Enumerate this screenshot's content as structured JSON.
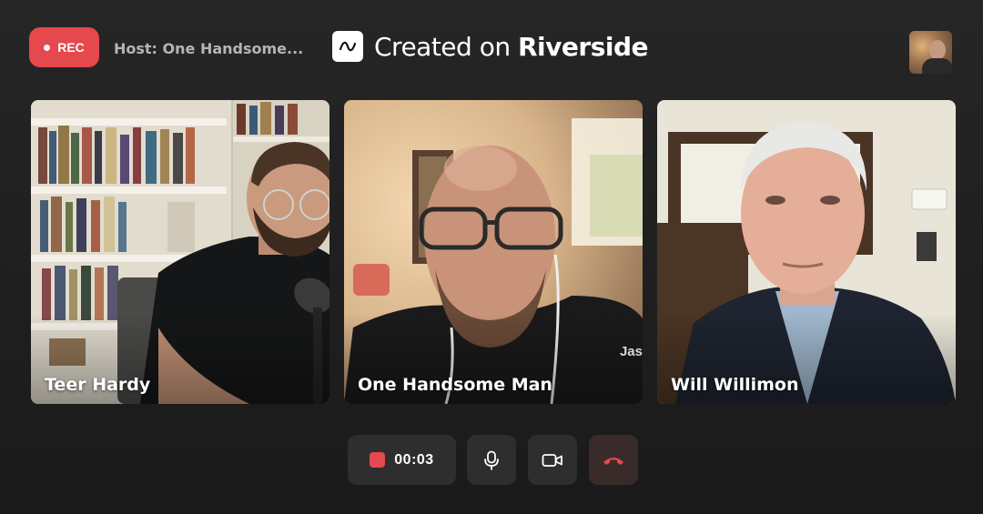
{
  "header": {
    "rec_label": "REC",
    "host_label": "Host: One Handsome...",
    "brand_prefix": "Created on ",
    "brand_name": "Riverside"
  },
  "participants": [
    {
      "name": "Teer Hardy"
    },
    {
      "name": "One Handsome Man",
      "overlay_text": "Jas"
    },
    {
      "name": "Will Willimon"
    }
  ],
  "controls": {
    "timer": "00:03",
    "mic_icon": "microphone-icon",
    "camera_icon": "video-camera-icon",
    "end_icon": "hang-up-phone-icon"
  },
  "colors": {
    "accent_red": "#e5484d",
    "background": "#1f1f1f",
    "control_bg": "#2e2e2e"
  }
}
